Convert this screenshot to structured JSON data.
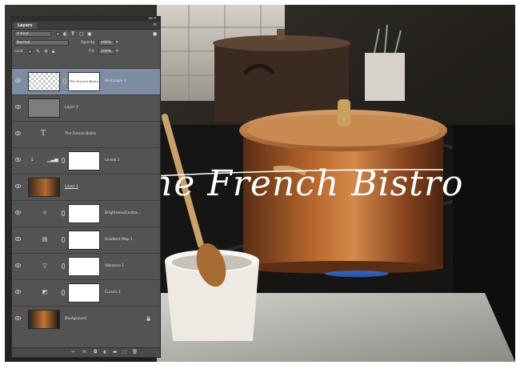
{
  "panel": {
    "tab_label": "Layers",
    "filter_kind": "Kind",
    "blend_mode": "Normal",
    "opacity_label": "Opacity:",
    "opacity_value": "100%",
    "lock_label": "Lock:",
    "fill_label": "Fill:",
    "fill_value": "100%"
  },
  "layers": [
    {
      "name": "Rectangle 1",
      "kind": "shape",
      "selected": true,
      "mask_text": "The French Bistro"
    },
    {
      "name": "Layer 2",
      "kind": "pixel"
    },
    {
      "name": "The French Bistro",
      "kind": "text"
    },
    {
      "name": "Levels 1",
      "kind": "adjustment",
      "icon": "levels-icon"
    },
    {
      "name": "Layer 1",
      "kind": "image"
    },
    {
      "name": "Brightness/Contra...",
      "kind": "adjustment",
      "icon": "brightness-icon"
    },
    {
      "name": "Gradient Map 1",
      "kind": "adjustment",
      "icon": "gradient-map-icon"
    },
    {
      "name": "Vibrance 1",
      "kind": "adjustment",
      "icon": "vibrance-icon"
    },
    {
      "name": "Curves 1",
      "kind": "adjustment",
      "icon": "curves-icon"
    },
    {
      "name": "Background",
      "kind": "background",
      "locked": true
    }
  ],
  "canvas": {
    "title_text": "he French Bistro"
  },
  "bottom_bar": {
    "link_icon": "∞",
    "fx_label": "fx."
  },
  "colors": {
    "panel_bg": "#535353",
    "selected_layer": "#7c8ca3",
    "copper": "#b5682f"
  }
}
